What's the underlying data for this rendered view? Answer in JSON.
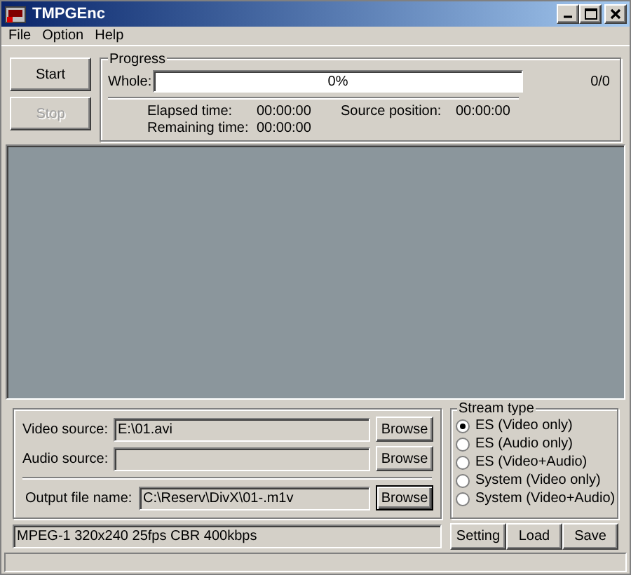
{
  "window": {
    "title": "TMPGEnc"
  },
  "menu": [
    "File",
    "Option",
    "Help"
  ],
  "buttons": {
    "start": {
      "label": "Start",
      "disabled": false
    },
    "stop": {
      "label": "Stop",
      "disabled": true
    }
  },
  "progress": {
    "title": "Progress",
    "whole_label": "Whole:",
    "level": 0,
    "percent": "0%",
    "count": "0/0",
    "elapsed_label": "Elapsed time:",
    "elapsed": "00:00:00",
    "remaining_label": "Remaining time:",
    "remaining": "00:00:00",
    "source_label": "Source position:",
    "source": "00:00:00"
  },
  "files": [
    {
      "label": "Video source:",
      "value": "E:\\01.avi",
      "button": "Browse",
      "focused": false
    },
    {
      "label": "Audio source:",
      "button": "Browse",
      "focused": false
    },
    {
      "label": "Output file name:",
      "value": "C:\\Reserv\\DivX\\01-.m1v",
      "button": "Browse",
      "focused": true
    }
  ],
  "stream_type": {
    "title": "Stream type",
    "options": [
      {
        "label": "ES (Video only)",
        "selected": true
      },
      {
        "label": "ES (Audio only)",
        "selected": false
      },
      {
        "label": "ES (Video+Audio)",
        "selected": false
      },
      {
        "label": "System (Video only)",
        "selected": false
      },
      {
        "label": "System (Video+Audio)",
        "selected": false
      }
    ]
  },
  "settings_summary": "MPEG-1 320x240 25fps CBR 400kbps",
  "actions": [
    "Setting",
    "Load",
    "Save"
  ]
}
